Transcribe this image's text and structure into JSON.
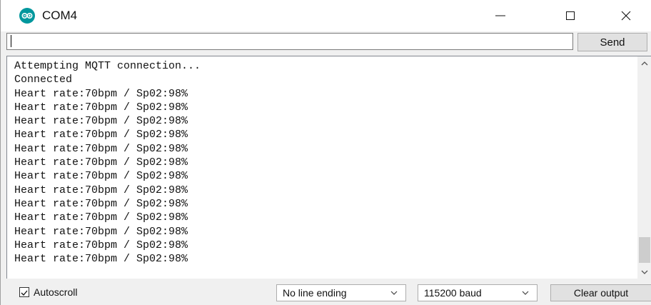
{
  "window": {
    "title": "COM4",
    "minimize_glyph": "—",
    "maximize_glyph": "☐",
    "close_glyph": "✕",
    "icon": "arduino-logo-icon",
    "accent_color": "#00979d"
  },
  "send_bar": {
    "input_value": "",
    "send_label": "Send"
  },
  "output": {
    "lines": [
      "Attempting MQTT connection...",
      "Connected",
      "Heart rate:70bpm / Sp02:98%",
      "Heart rate:70bpm / Sp02:98%",
      "Heart rate:70bpm / Sp02:98%",
      "Heart rate:70bpm / Sp02:98%",
      "Heart rate:70bpm / Sp02:98%",
      "Heart rate:70bpm / Sp02:98%",
      "Heart rate:70bpm / Sp02:98%",
      "Heart rate:70bpm / Sp02:98%",
      "Heart rate:70bpm / Sp02:98%",
      "Heart rate:70bpm / Sp02:98%",
      "Heart rate:70bpm / Sp02:98%",
      "Heart rate:70bpm / Sp02:98%",
      "Heart rate:70bpm / Sp02:98%"
    ]
  },
  "bottom_bar": {
    "autoscroll_label": "Autoscroll",
    "autoscroll_checked": true,
    "line_ending_value": "No line ending",
    "baud_value": "115200 baud",
    "clear_label": "Clear output"
  }
}
